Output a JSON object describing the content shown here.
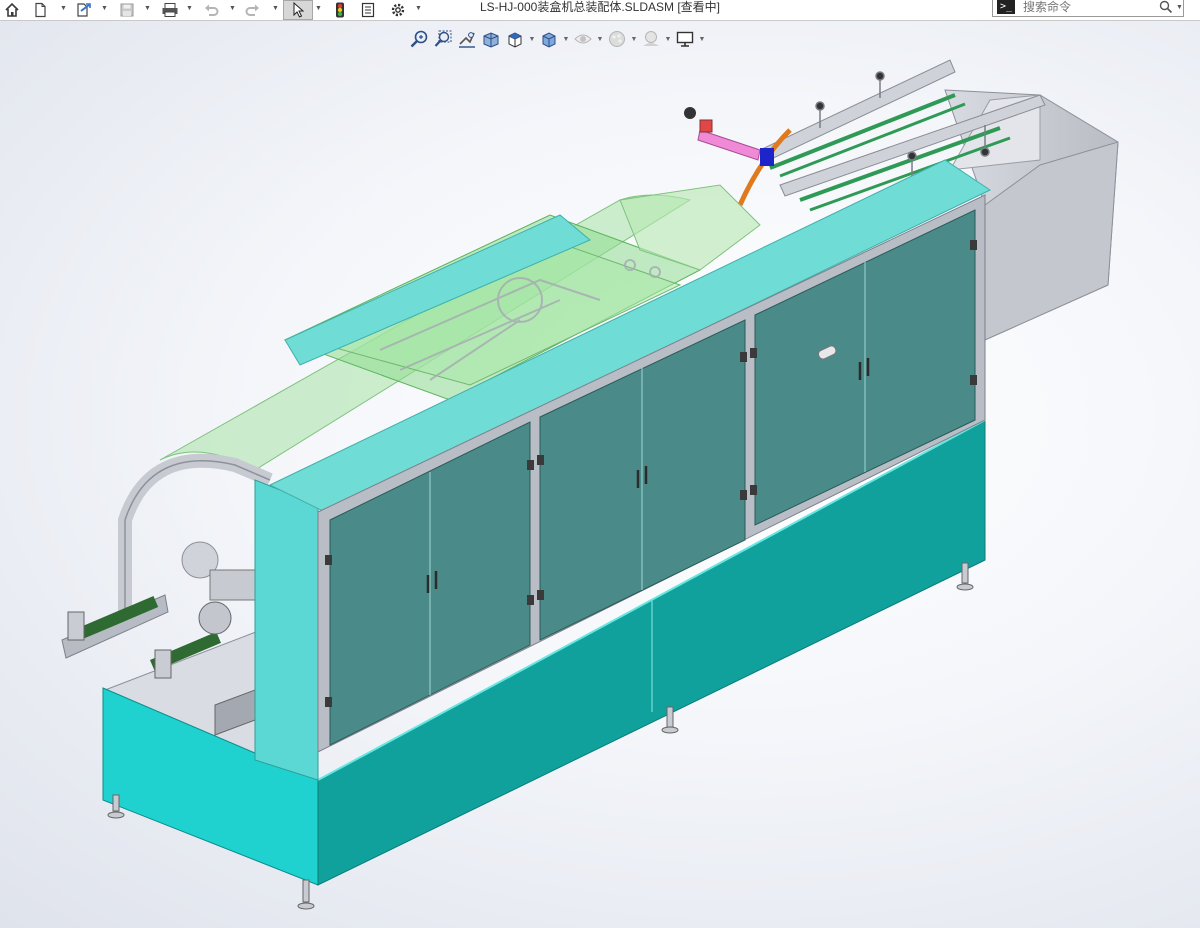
{
  "titlebar": {
    "document_title": "LS-HJ-000装盒机总装配体.SLDASM [查看中]",
    "search_placeholder": "搜索命令",
    "icons": [
      "home-icon",
      "new-document-icon",
      "open-icon",
      "save-icon",
      "print-icon",
      "undo-icon",
      "redo-icon",
      "select-cursor-icon",
      "rebuild-traffic-light-icon",
      "file-properties-icon",
      "options-gear-icon",
      "command-prompt-icon",
      "search-icon"
    ]
  },
  "headsup_toolbar": {
    "icons": [
      "zoom-to-fit-icon",
      "zoom-to-area-icon",
      "previous-view-icon",
      "section-view-icon",
      "view-orientation-icon",
      "display-style-icon",
      "hide-show-items-icon",
      "edit-appearance-icon",
      "apply-scene-icon",
      "view-settings-icon"
    ]
  },
  "colors": {
    "cabinet_top": "#6fdcd6",
    "cabinet_upper_panel": "#4a8b89",
    "cabinet_lower_panel": "#12a5a0",
    "cabinet_lower_side": "#20d2d0",
    "glass_cover": "#9fe0a0",
    "conveyor_rail": "#2e9a55",
    "frame_grey": "#c8cbd2"
  }
}
